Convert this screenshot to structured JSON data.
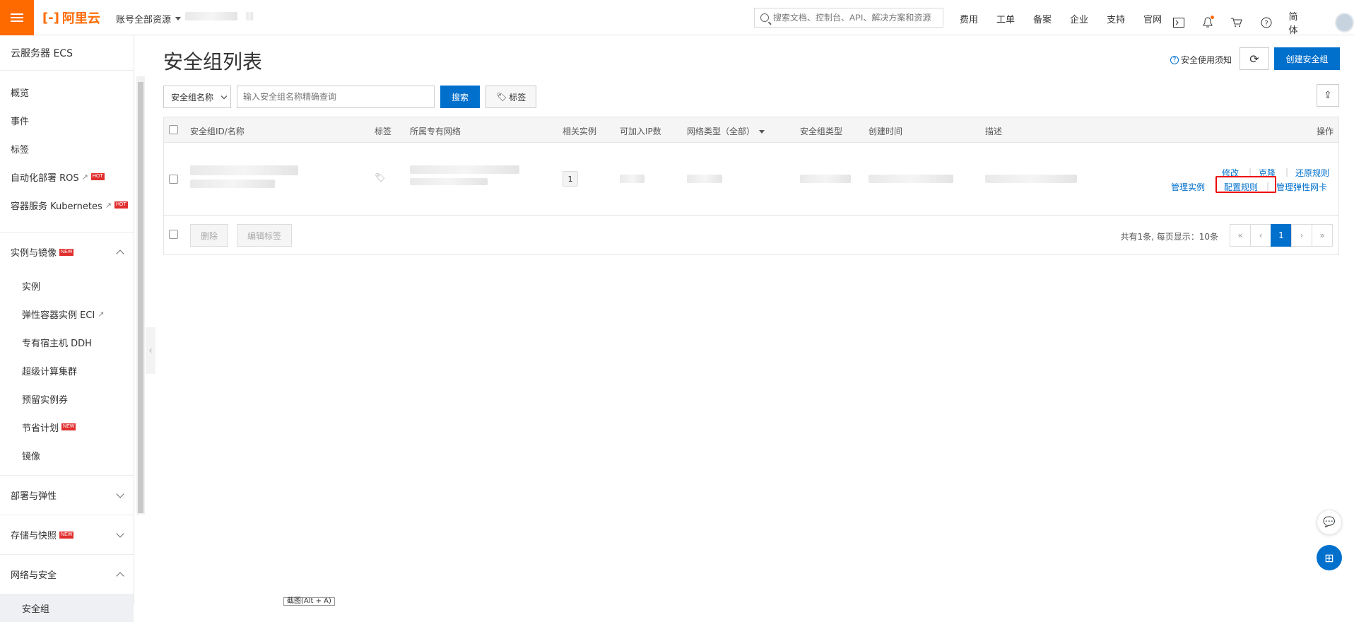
{
  "topbar": {
    "logo_text": "阿里云",
    "account_label": "账号全部资源",
    "search_placeholder": "搜索文档、控制台、API、解决方案和资源",
    "nav": [
      "费用",
      "工单",
      "备案",
      "企业",
      "支持",
      "官网"
    ],
    "lang": "简体"
  },
  "sidebar": {
    "title": "云服务器 ECS",
    "items": [
      {
        "label": "概览"
      },
      {
        "label": "事件"
      },
      {
        "label": "标签"
      },
      {
        "label": "自动化部署 ROS",
        "badge": "HOT"
      },
      {
        "label": "容器服务 Kubernetes",
        "badge": "HOT"
      }
    ],
    "group_instances": {
      "label": "实例与镜像",
      "badge": "NEW"
    },
    "sub_items": [
      {
        "label": "实例"
      },
      {
        "label": "弹性容器实例 ECI"
      },
      {
        "label": "专有宿主机 DDH"
      },
      {
        "label": "超级计算集群"
      },
      {
        "label": "预留实例券"
      },
      {
        "label": "节省计划",
        "badge": "NEW"
      },
      {
        "label": "镜像"
      }
    ],
    "group_deploy": {
      "label": "部署与弹性"
    },
    "group_storage": {
      "label": "存储与快照",
      "badge": "NEW"
    },
    "group_network": {
      "label": "网络与安全"
    },
    "active_item": {
      "label": "安全组"
    }
  },
  "main": {
    "title": "安全组列表",
    "notice_link": "安全使用须知",
    "create_button": "创建安全组",
    "filter_select": "安全组名称",
    "filter_placeholder": "输入安全组名称精确查询",
    "search_button": "搜索",
    "tag_button": "标签",
    "table": {
      "headers": [
        "安全组ID/名称",
        "标签",
        "所属专有网络",
        "相关实例",
        "可加入IP数",
        "网络类型（全部）",
        "安全组类型",
        "创建时间",
        "描述",
        "操作"
      ],
      "row": {
        "related_instances": "1",
        "actions": [
          "修改",
          "克隆",
          "还原规则",
          "管理实例",
          "配置规则",
          "管理弹性网卡"
        ]
      }
    },
    "footer": {
      "delete_button": "删除",
      "edit_tags_button": "编辑标签",
      "total_text": "共有1条, 每页显示：10条",
      "pager": [
        "«",
        "‹",
        "1",
        "›",
        "»"
      ]
    }
  },
  "snip_tooltip": "截图(Alt + A)",
  "colors": {
    "accent": "#ff6a00",
    "primary": "#0070cc",
    "highlight": "#e00000"
  }
}
